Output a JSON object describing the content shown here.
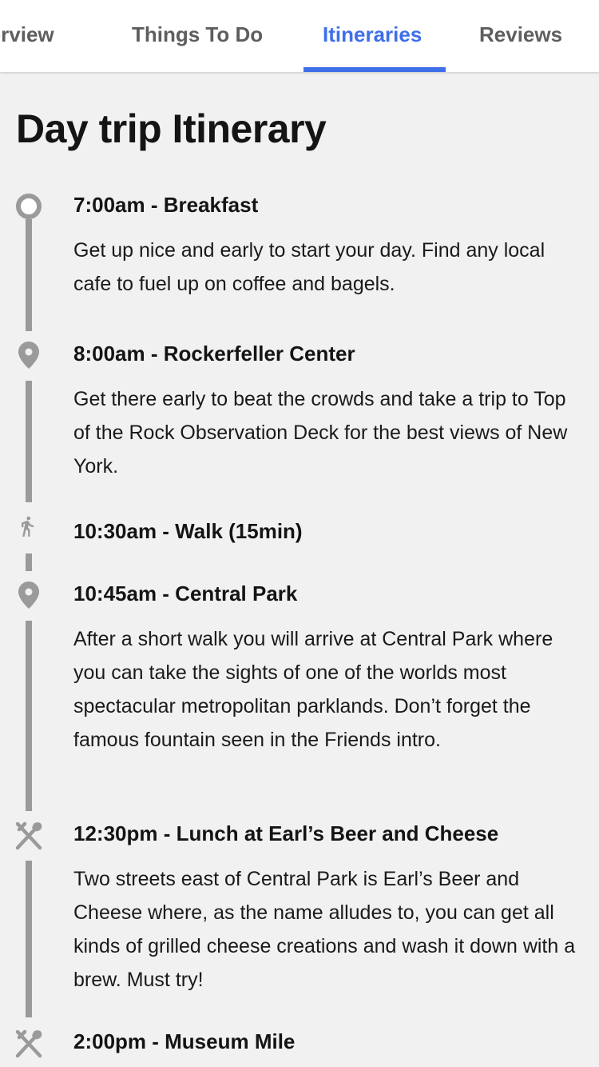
{
  "tabs": [
    {
      "label": "Overview",
      "active": false
    },
    {
      "label": "Things To Do",
      "active": false
    },
    {
      "label": "Itineraries",
      "active": true
    },
    {
      "label": "Reviews",
      "active": false
    }
  ],
  "title": "Day trip Itinerary",
  "stops": [
    {
      "icon": "start-circle-icon",
      "title": "7:00am - Breakfast",
      "description": "Get up nice and early to start your day. Find any local cafe to fuel up on coffee and bagels."
    },
    {
      "icon": "location-pin-icon",
      "title": "8:00am - Rockerfeller Center",
      "description": "Get there early to beat the crowds and take a trip to Top of the Rock Observation Deck for the best views of New York."
    },
    {
      "icon": "walking-icon",
      "title": "10:30am - Walk (15min)",
      "description": ""
    },
    {
      "icon": "location-pin-icon",
      "title": "10:45am - Central Park",
      "description": "After a short walk you will arrive at Central Park where you can take the sights of one of the worlds most spectacular metropolitan parklands. Don’t forget the famous fountain seen in the Friends intro."
    },
    {
      "icon": "restaurant-icon",
      "title": "12:30pm - Lunch at Earl’s Beer and Cheese",
      "description": "Two streets east of Central Park is Earl’s Beer and Cheese where, as the name alludes to, you can get all kinds of grilled cheese creations and wash it down with a brew. Must try!"
    },
    {
      "icon": "restaurant-icon",
      "title": "2:00pm - Museum Mile",
      "description": ""
    }
  ],
  "colors": {
    "accent": "#3f6fe8",
    "rail": "#9a9a9a",
    "background": "#f1f1f1"
  }
}
